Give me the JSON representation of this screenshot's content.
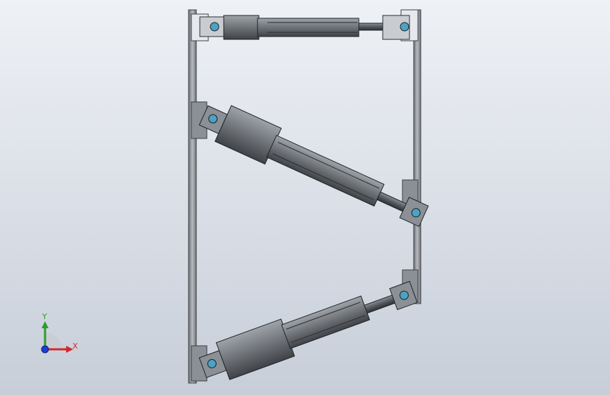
{
  "viewport": {
    "background_top": "#eef1f5",
    "background_bottom": "#c7ced8"
  },
  "model": {
    "frame_color": "#9aa0a6",
    "actuator_body_color": "#6f7378",
    "actuator_dark_color": "#3f4246",
    "rod_color": "#555a60",
    "clevis_color": "#c9ccd0",
    "pin_color": "#4aa3c4"
  },
  "triad": {
    "y_label": "Y",
    "x_label": "X",
    "x_axis_color": "#d12a2a",
    "y_axis_color": "#2e9b2e",
    "z_axis_color": "#1f3fd1",
    "icon": "coordinate-triad-icon"
  }
}
